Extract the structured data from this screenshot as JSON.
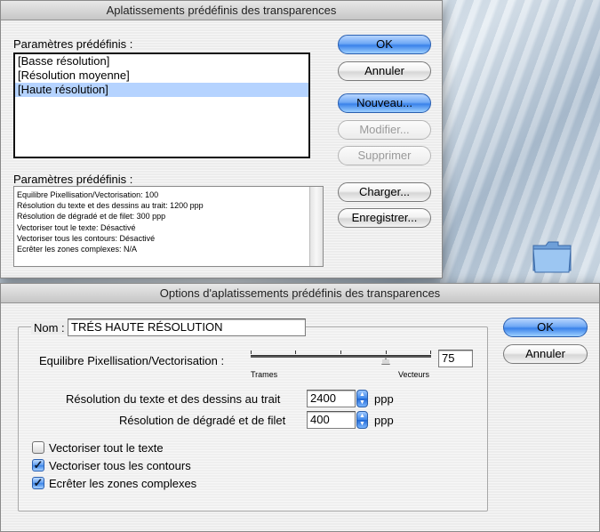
{
  "top_dialog": {
    "title": "Aplatissements prédéfinis des transparences",
    "presets_label": "Paramètres prédéfinis :",
    "presets": [
      "[Basse résolution]",
      "[Résolution moyenne]",
      "[Haute résolution]"
    ],
    "selected_preset_index": 2,
    "details_label": "Paramètres prédéfinis :",
    "details": [
      "Equilibre Pixellisation/Vectorisation: 100",
      "Résolution du texte et des dessins au trait: 1200 ppp",
      "Résolution de dégradé et de filet: 300 ppp",
      "Vectoriser tout le texte: Désactivé",
      "Vectoriser tous les contours: Désactivé",
      "Ecrêter les zones complexes: N/A"
    ],
    "buttons": {
      "ok": "OK",
      "cancel": "Annuler",
      "new": "Nouveau...",
      "modify": "Modifier...",
      "delete": "Supprimer",
      "load": "Charger...",
      "save": "Enregistrer..."
    }
  },
  "bottom_dialog": {
    "title": "Options d'aplatissements prédéfinis des transparences",
    "name_label": "Nom :",
    "name_value": "TRÉS HAUTE RÉSOLUTION",
    "balance_label": "Equilibre Pixellisation/Vectorisation :",
    "balance_value": "75",
    "balance_fraction": 0.75,
    "slider_min_label": "Trames",
    "slider_max_label": "Vecteurs",
    "text_res_label": "Résolution du texte et des dessins au trait",
    "text_res_value": "2400",
    "gradient_res_label": "Résolution de dégradé et de filet",
    "gradient_res_value": "400",
    "unit": "ppp",
    "checkboxes": [
      {
        "label": "Vectoriser tout le texte",
        "checked": false
      },
      {
        "label": "Vectoriser tous les contours",
        "checked": true
      },
      {
        "label": "Ecrêter les zones complexes",
        "checked": true
      }
    ],
    "buttons": {
      "ok": "OK",
      "cancel": "Annuler"
    }
  },
  "colors": {
    "accent_blue": "#3a82ea",
    "selection": "#b5d3ff",
    "window_bg": "#ececec"
  },
  "icons": {
    "desktop_folder": "folder-icon"
  }
}
